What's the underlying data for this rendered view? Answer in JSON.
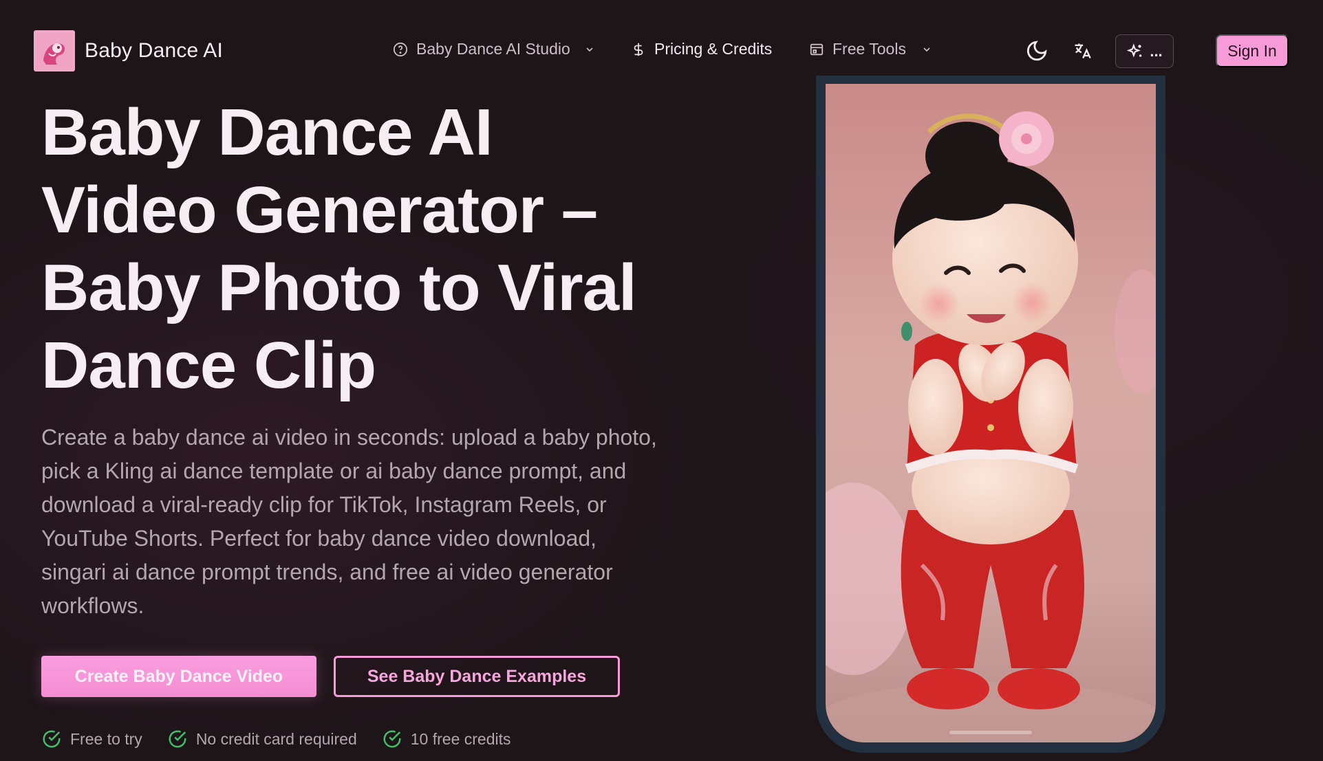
{
  "brand": {
    "name": "Baby Dance AI"
  },
  "nav": {
    "studio": "Baby Dance AI Studio",
    "pricing": "Pricing & Credits",
    "free_tools": "Free Tools",
    "more": "...",
    "sign_in": "Sign In"
  },
  "icons": {
    "studio": "help-circle-icon",
    "pricing": "dollar-icon",
    "free_tools": "browser-window-icon",
    "theme": "moon-icon",
    "language": "translate-icon",
    "more": "sparkles-icon"
  },
  "hero": {
    "title": "Baby Dance AI Video Generator – Baby Photo to Viral Dance Clip",
    "description": "Create a baby dance ai video in seconds: upload a baby photo, pick a Kling ai dance template or ai baby dance prompt, and download a viral-ready clip for TikTok, Instagram Reels, or YouTube Shorts. Perfect for baby dance video download, singari ai dance prompt trends, and free ai video generator workflows.",
    "cta_primary": "Create Baby Dance Video",
    "cta_secondary": "See Baby Dance Examples",
    "features": [
      {
        "label": "Free to try"
      },
      {
        "label": "No credit card required"
      },
      {
        "label": "10 free credits"
      }
    ]
  },
  "colors": {
    "background": "#1e1519",
    "accent": "#f79ad8",
    "check": "#3fbf6a",
    "phone_frame": "#23303f"
  }
}
